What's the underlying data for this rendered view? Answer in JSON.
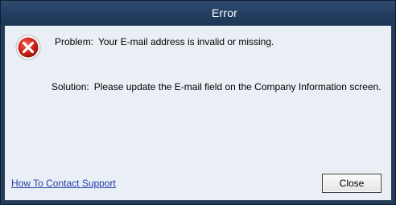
{
  "window": {
    "title": "Error"
  },
  "message": {
    "icon": "error-icon",
    "problem_label": "Problem:",
    "problem_text": "Your E-mail address is invalid or missing.",
    "solution_label": "Solution:",
    "solution_text": "Please update the E-mail field on the Company Information screen."
  },
  "footer": {
    "support_link_label": "How To Contact Support",
    "close_label": "Close"
  },
  "colors": {
    "titlebar": "#253c59",
    "client_background": "#eaeff5",
    "error_red": "#cc1f1f",
    "link": "#1f3fa8"
  }
}
